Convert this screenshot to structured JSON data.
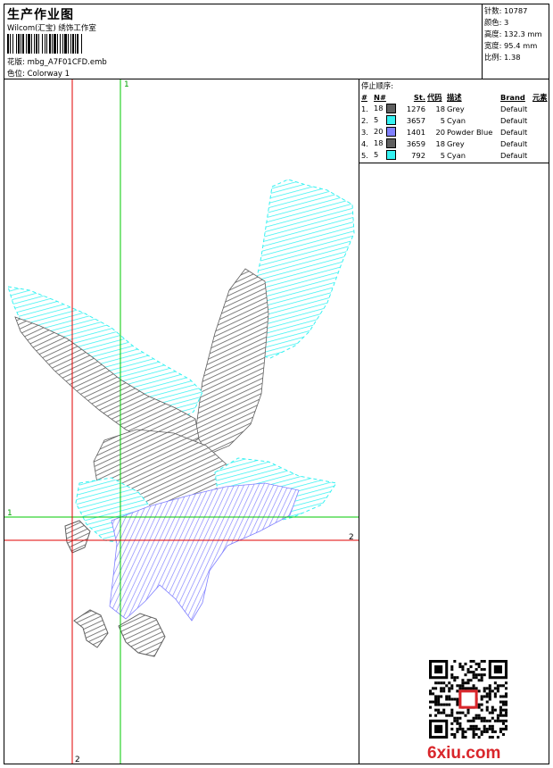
{
  "header": {
    "title": "生产作业图",
    "subtitle": "Wilcom(汇宝) 绣饰工作室",
    "design_file": "花版: mbg_A7F01CFD.emb",
    "colorway": "色位: Colorway 1"
  },
  "stats": {
    "stitches": "针数: 10787",
    "colors": "颜色: 3",
    "height": "高度: 132.3 mm",
    "width": "宽度: 95.4 mm",
    "scale": "比例: 1.38"
  },
  "stop_sequence": {
    "title": "停止顺序:",
    "columns": [
      "#",
      "N#",
      "St.",
      "代码",
      "描述",
      "Brand",
      "元素"
    ],
    "rows": [
      {
        "num": "1.",
        "needle": "18",
        "color": "#5f5f5f",
        "stitches": "1276",
        "code": "18",
        "desc": "Grey",
        "brand": "Default"
      },
      {
        "num": "2.",
        "needle": "5",
        "color": "#35f2f2",
        "stitches": "3657",
        "code": "5",
        "desc": "Cyan",
        "brand": "Default"
      },
      {
        "num": "3.",
        "needle": "20",
        "color": "#8080ff",
        "stitches": "1401",
        "code": "20",
        "desc": "Powder Blue",
        "brand": "Default"
      },
      {
        "num": "4.",
        "needle": "18",
        "color": "#5f5f5f",
        "stitches": "3659",
        "code": "18",
        "desc": "Grey",
        "brand": "Default"
      },
      {
        "num": "5.",
        "needle": "5",
        "color": "#35f2f2",
        "stitches": "792",
        "code": "5",
        "desc": "Cyan",
        "brand": "Default"
      }
    ]
  },
  "guides": {
    "green_label": "1",
    "red_label": "2"
  },
  "watermark": {
    "site": "6xiu.com"
  },
  "colors": {
    "grey_thread": "#5f5f5f",
    "cyan_thread": "#35f2f2",
    "powder_blue_thread": "#8080ff",
    "guide_green": "#00c800",
    "guide_red": "#e00000"
  }
}
